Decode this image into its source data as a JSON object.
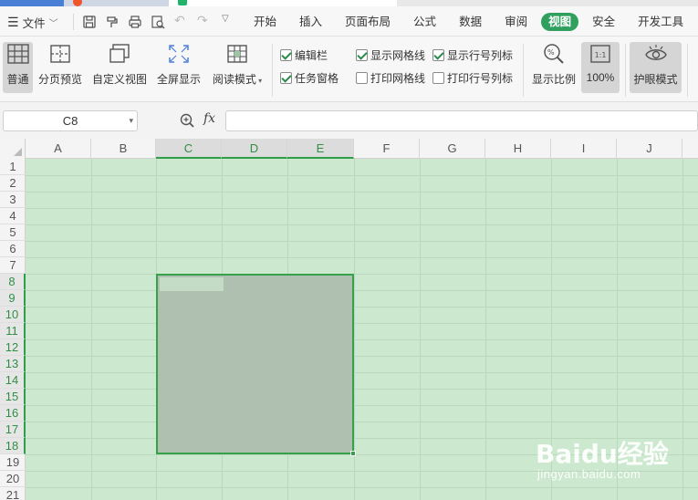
{
  "menubar": {
    "file_label": "文件",
    "tabs": [
      "开始",
      "插入",
      "页面布局",
      "公式",
      "数据",
      "审阅",
      "视图",
      "安全",
      "开发工具"
    ],
    "active_tab": "视图"
  },
  "ribbon": {
    "views": [
      "普通",
      "分页预览",
      "自定义视图",
      "全屏显示",
      "阅读模式"
    ],
    "checks": [
      {
        "label": "编辑栏",
        "checked": true
      },
      {
        "label": "任务窗格",
        "checked": true
      },
      {
        "label": "显示网格线",
        "checked": true
      },
      {
        "label": "打印网格线",
        "checked": false
      },
      {
        "label": "显示行号列标",
        "checked": true
      },
      {
        "label": "打印行号列标",
        "checked": false
      }
    ],
    "zoom_label": "显示比例",
    "zoom_100": "100%",
    "zoom_100_icon_text": "1:1",
    "eye_mode": "护眼模式"
  },
  "formula_bar": {
    "name_box": "C8",
    "fx": "fx",
    "value": ""
  },
  "sheet": {
    "columns": [
      "A",
      "B",
      "C",
      "D",
      "E",
      "F",
      "G",
      "H",
      "I",
      "J"
    ],
    "rows": [
      "1",
      "2",
      "3",
      "4",
      "5",
      "6",
      "7",
      "8",
      "9",
      "10",
      "11",
      "12",
      "13",
      "14",
      "15",
      "16",
      "17",
      "18",
      "19",
      "20",
      "21"
    ],
    "selected_columns": [
      "C",
      "D",
      "E"
    ],
    "selected_rows": [
      "8",
      "9",
      "10",
      "11",
      "12",
      "13",
      "14",
      "15",
      "16",
      "17",
      "18"
    ],
    "selection": "C8:E18",
    "background_color": "#cce8cf",
    "accent_color": "#31a05f"
  },
  "watermark": {
    "brand": "Baidu经验",
    "url": "jingyan.baidu.com"
  }
}
